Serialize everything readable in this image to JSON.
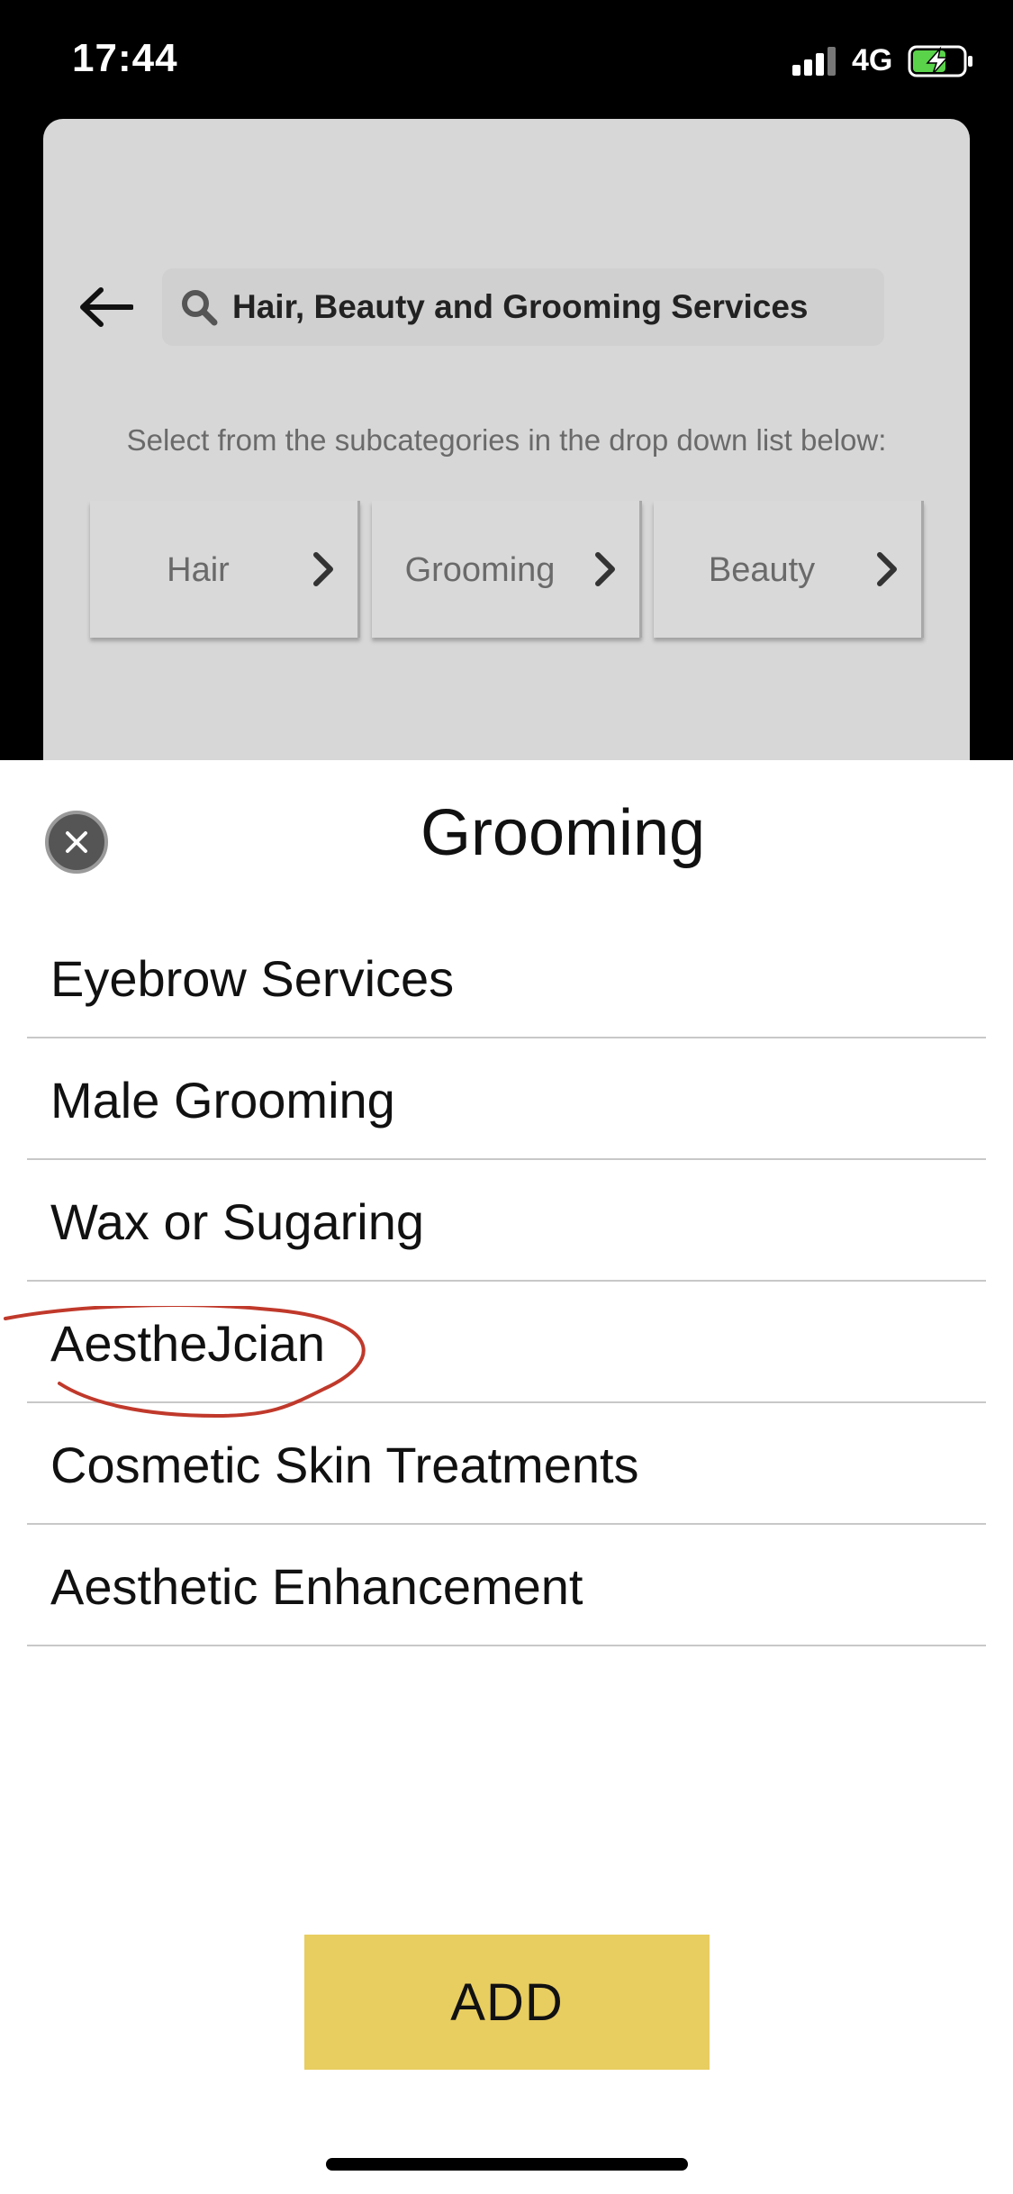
{
  "status_bar": {
    "time": "17:44",
    "network": "4G",
    "icons": [
      "signal-icon",
      "battery-charging-icon"
    ]
  },
  "header": {
    "back_icon": "back-arrow-icon",
    "search_icon": "search-icon",
    "search_text": "Hair, Beauty and Grooming Services"
  },
  "instructions": "Select from the subcategories in the drop down list below:",
  "subcategories": [
    {
      "label": "Hair"
    },
    {
      "label": "Grooming"
    },
    {
      "label": "Beauty"
    }
  ],
  "sheet": {
    "close_icon": "close-icon",
    "title": "Grooming",
    "options": [
      {
        "label": "Eyebrow Services"
      },
      {
        "label": "Male Grooming"
      },
      {
        "label": "Wax or Sugaring"
      },
      {
        "label": "AestheJcian"
      },
      {
        "label": "Cosmetic Skin Treatments"
      },
      {
        "label": "Aesthetic Enhancement"
      }
    ],
    "add_label": "ADD"
  },
  "colors": {
    "add_button": "#e8cd60",
    "annotation": "#c0392b",
    "overlay_card": "#d7d7d7"
  }
}
